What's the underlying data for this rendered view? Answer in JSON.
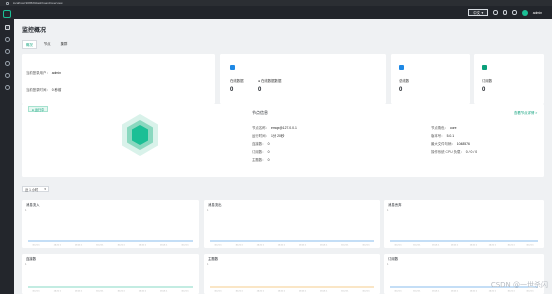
{
  "browser": {
    "url": "localhost:9095/#/dashboard/overview"
  },
  "header": {
    "lang": "中文",
    "user": "admin"
  },
  "page": {
    "title": "监控概况"
  },
  "tabs": [
    {
      "label": "概况"
    },
    {
      "label": "节点"
    },
    {
      "label": "集群"
    }
  ],
  "info": {
    "row1": {
      "label": "当前登录用户：",
      "value": "admin"
    },
    "row2": {
      "label": "当前登录时间：",
      "value": "0 秒前"
    }
  },
  "stats": [
    {
      "label": "在线数据",
      "value": "0",
      "color": "#1e88e5"
    },
    {
      "label": "● 在线数据数据",
      "value": "0",
      "color": "#1bbf95"
    },
    {
      "label": "总线数",
      "value": "0",
      "color": "#1e88e5"
    },
    {
      "label": "订阅数",
      "value": "0",
      "color": "#0a9f7a"
    }
  ],
  "node": {
    "status": "● 运行中",
    "title": "节点信息",
    "more": "查看节点详情 >",
    "left": [
      {
        "label": "节点名称：",
        "value": "emqx@127.0.0.1"
      },
      {
        "label": "运行时间：",
        "value": "1分 20秒"
      },
      {
        "label": "连接数：",
        "value": "0"
      },
      {
        "label": "订阅数：",
        "value": "0"
      },
      {
        "label": "主题数：",
        "value": "0"
      }
    ],
    "right": [
      {
        "label": "节点角色：",
        "value": "core"
      },
      {
        "label": "版本号：",
        "value": "5.0.1"
      },
      {
        "label": "最大文件句柄：",
        "value": "1048576"
      },
      {
        "label": "操作系统 CPU 负载：",
        "value": "0 / 0 / 0"
      }
    ]
  },
  "select": {
    "value": "近 1 小时"
  },
  "charts": [
    {
      "title": "消息流入",
      "color": "#1e88e5",
      "ylim": [
        0,
        1
      ],
      "values": [
        0,
        0,
        0,
        0,
        0,
        0,
        0,
        0,
        0,
        0
      ],
      "ticks": [
        "16:21:1",
        "16:21:1",
        "16:21:1",
        "16:21:1",
        "16:21:1",
        "16:21:1",
        "16:21:1",
        "16:21:1"
      ]
    },
    {
      "title": "消息流出",
      "color": "#1e88e5",
      "ylim": [
        0,
        1
      ],
      "values": [
        0,
        0,
        0,
        0,
        0,
        0,
        0,
        0,
        0,
        0
      ],
      "ticks": [
        "16:21:1",
        "16:21:1",
        "16:21:1",
        "16:21:1",
        "16:21:1",
        "16:21:1",
        "16:21:1",
        "16:21:1"
      ]
    },
    {
      "title": "消息丢弃",
      "color": "#1e88e5",
      "ylim": [
        0,
        1
      ],
      "values": [
        0,
        0,
        0,
        0,
        0,
        0,
        0,
        0,
        0,
        0
      ],
      "ticks": [
        "16:21:1",
        "16:21:1",
        "16:21:1",
        "16:21:1",
        "16:21:1",
        "16:21:1",
        "16:21:1",
        "16:21:1"
      ]
    },
    {
      "title": "连接数",
      "color": "#1bbf95",
      "ylim": [
        0,
        1
      ],
      "values": [
        0,
        0,
        0,
        0,
        0,
        0,
        0,
        0,
        0,
        0
      ],
      "ticks": [
        "16:21:1",
        "16:21:1",
        "16:21:1",
        "16:21:1",
        "16:21:1",
        "16:21:1",
        "16:21:1",
        "16:21:1"
      ]
    },
    {
      "title": "主题数",
      "color": "#f5a623",
      "ylim": [
        0,
        1
      ],
      "values": [
        0,
        0,
        0,
        0,
        0,
        0,
        0,
        0,
        0,
        0
      ],
      "ticks": [
        "16:21:1",
        "16:21:1",
        "16:21:1",
        "16:21:1",
        "16:21:1",
        "16:21:1",
        "16:21:1",
        "16:21:1"
      ]
    },
    {
      "title": "订阅数",
      "color": "#1e88e5",
      "ylim": [
        0,
        1
      ],
      "values": [
        0,
        0,
        0,
        0,
        0,
        0,
        0,
        0,
        0,
        0
      ],
      "ticks": [
        "16:21:1",
        "16:21:1",
        "16:21:1",
        "16:21:1",
        "16:21:1",
        "16:21:1",
        "16:21:1",
        "16:21:1"
      ]
    }
  ],
  "watermark": "CSDN @一世杀闪"
}
